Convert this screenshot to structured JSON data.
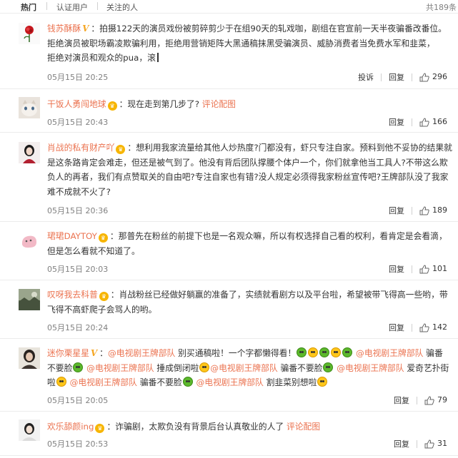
{
  "tabs": [
    {
      "label": "热门",
      "active": true
    },
    {
      "label": "认证用户",
      "active": false
    },
    {
      "label": "关注的人",
      "active": false
    }
  ],
  "total": "共189条",
  "actions": {
    "report": "投诉",
    "reply": "回复"
  },
  "comments": [
    {
      "user": "钱苏酥酥",
      "badge": "V",
      "time": "05月15日 20:25",
      "likes": "296",
      "has_report": true,
      "text1": "：拍摄122天的演员戏份被剪碎剪少于在组90天的轧戏咖，剧组在官宣前一天半夜骗番改番位。",
      "text2": "拒绝演员被职场霸凌欺骗利用，拒绝用营销矩阵大黑通稿抹黑受骗演员、威胁消费者当免费水军和韭菜，",
      "text3": "拒绝对演员和观众的pua，滚"
    },
    {
      "user": "干饭人勇闯地球",
      "badge": "crown",
      "time": "05月15日 20:43",
      "likes": "166",
      "text1": "：现在走到第几步了?",
      "link": "评论配图"
    },
    {
      "user": "肖战的私有财产吖",
      "badge": "crown",
      "time": "05月15日 20:36",
      "likes": "189",
      "text1": "：想利用我家流量给其他人炒热度?门都没有，虾只专注自家。预料到他不妥协的结果就",
      "text2": "是这条路肯定会难走，但还是被气到了。他没有背后团队撑腰个体户一个，你们就拿他当工具人?不带这么欺",
      "text3": "负人的再者，我们有点赞取关的自由吧?专注自家也有错?没人规定必须得我家粉丝宣传吧?王牌部队没了我家",
      "text4": "难不成就不火了?"
    },
    {
      "user": "珺珺DAYTOY",
      "badge": "crown",
      "time": "05月15日 20:03",
      "likes": "101",
      "text1": "：那普先在粉丝的前提下也是一名观众嘛，所以有权选择自己看的权利，看肯定是会看滴，",
      "text2": "但是怎么看就不知道了。"
    },
    {
      "user": "叹呀我去科普",
      "badge": "crown",
      "time": "05月15日 20:24",
      "likes": "142",
      "text1": "：肖战粉丝已经做好躺赢的准备了，实绩就看剧方以及平台啦，希望被带飞得高一些哟，带",
      "text2": "飞得不高虾爬子会骂人的哟。"
    },
    {
      "user": "迷你栗星星",
      "badge": "V",
      "time": "05月15日 20:05",
      "likes": "79",
      "mention": "@电视剧王牌部队",
      "t_a": "：",
      "t_b": "别买通稿啦！一个字都懒得看！",
      "t_c": "骗番",
      "t_d": "不要脸",
      "t_e": "捶成倒闭啦",
      "t_f": "爱奇艺扑街",
      "t_g": "啦",
      "t_h": "割韭菜别想啦"
    },
    {
      "user": "欢乐舔颜ing",
      "badge": "crown",
      "time": "05月15日 20:53",
      "likes": "31",
      "text1": "：诈骗剧，太欺负没有背景后台认真敬业的人了",
      "link": "评论配图"
    }
  ]
}
